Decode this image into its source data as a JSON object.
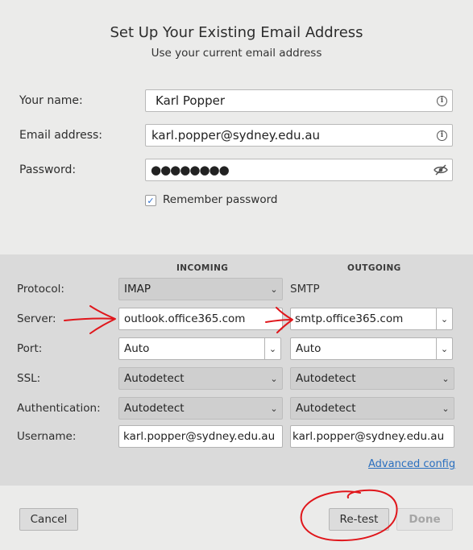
{
  "header": {
    "title": "Set Up Your Existing Email Address",
    "subtitle": "Use your current email address"
  },
  "account": {
    "name_label": "Your name:",
    "name_value": "Karl Popper",
    "email_label": "Email address:",
    "email_value": "karl.popper@sydney.edu.au",
    "password_label": "Password:",
    "password_value": "●●●●●●●●",
    "remember_label": "Remember password",
    "remember_checked": true
  },
  "settings": {
    "incoming_header": "INCOMING",
    "outgoing_header": "OUTGOING",
    "labels": {
      "protocol": "Protocol:",
      "server": "Server:",
      "port": "Port:",
      "ssl": "SSL:",
      "authentication": "Authentication:",
      "username": "Username:"
    },
    "incoming": {
      "protocol": "IMAP",
      "server": "outlook.office365.com",
      "port": "Auto",
      "ssl": "Autodetect",
      "authentication": "Autodetect",
      "username": "karl.popper@sydney.edu.au"
    },
    "outgoing": {
      "protocol": "SMTP",
      "server": "smtp.office365.com",
      "port": "Auto",
      "ssl": "Autodetect",
      "authentication": "Autodetect",
      "username": "karl.popper@sydney.edu.au"
    },
    "advanced_link": "Advanced config"
  },
  "footer": {
    "cancel": "Cancel",
    "retest": "Re-test",
    "done": "Done"
  },
  "icons": {
    "info": "info-icon",
    "eye": "eye-slash-icon",
    "dropdown": "chevron-down-icon",
    "check": "checkmark-icon"
  },
  "colors": {
    "annotation": "#e0161b",
    "link": "#2a6fbf",
    "panel": "#dadada"
  }
}
